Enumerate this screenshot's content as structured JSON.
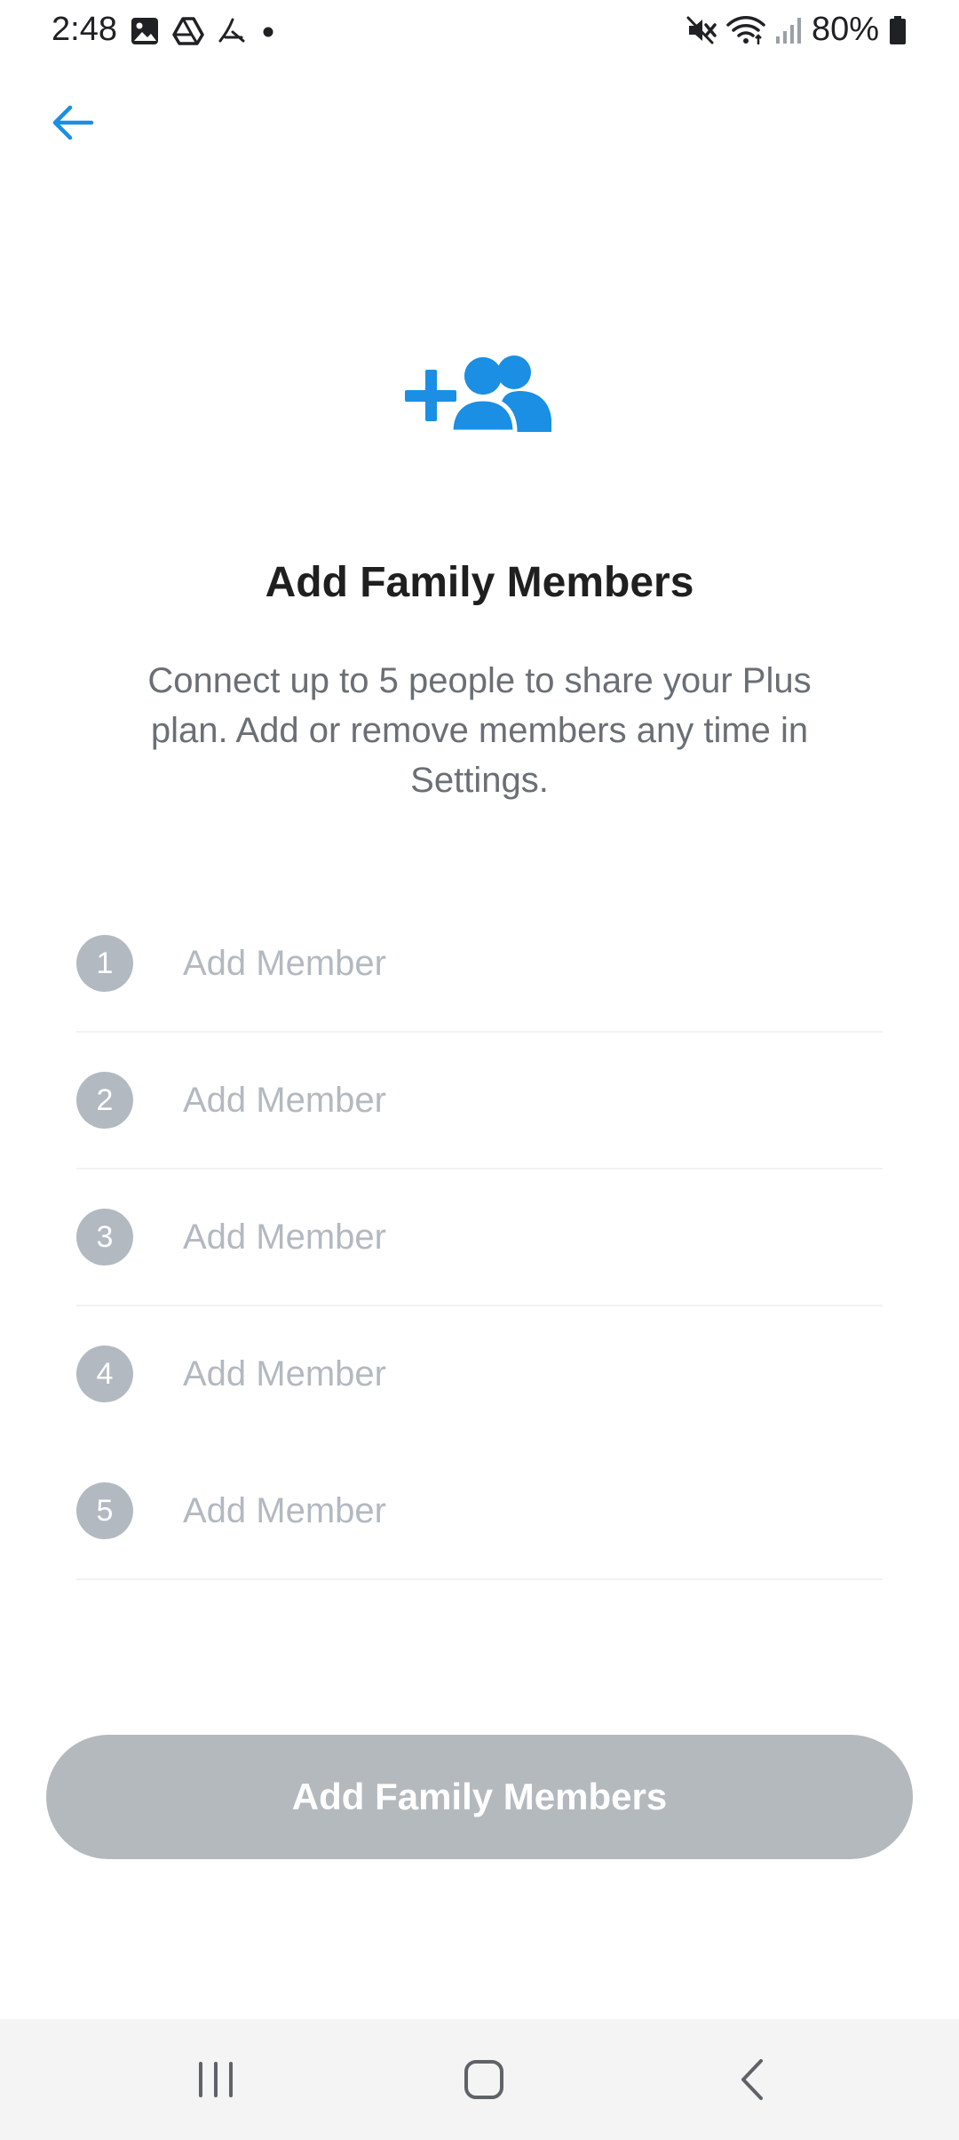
{
  "status_bar": {
    "time": "2:48",
    "battery": "80%",
    "left_icons": [
      "image-icon",
      "drive-icon",
      "app-icon",
      "dot-icon"
    ],
    "right_icons": [
      "mute-icon",
      "wifi-icon",
      "signal-icon",
      "battery-icon"
    ]
  },
  "header": {
    "back_icon": "arrow-left-icon"
  },
  "hero": {
    "icon": "add-group-icon",
    "title": "Add Family Members",
    "subtitle": "Connect up to 5 people to share your Plus plan. Add or remove members any time in Settings."
  },
  "members": [
    {
      "number": "1",
      "placeholder": "Add Member"
    },
    {
      "number": "2",
      "placeholder": "Add Member"
    },
    {
      "number": "3",
      "placeholder": "Add Member"
    },
    {
      "number": "4",
      "placeholder": "Add Member"
    },
    {
      "number": "5",
      "placeholder": "Add Member"
    }
  ],
  "primary_button": {
    "label": "Add Family Members"
  },
  "nav_bar": {
    "buttons": [
      "recents-icon",
      "home-icon",
      "back-icon"
    ]
  },
  "colors": {
    "accent": "#1a8fe3",
    "disabled_button": "#b4b9be",
    "number_badge": "#b3b9c0"
  }
}
